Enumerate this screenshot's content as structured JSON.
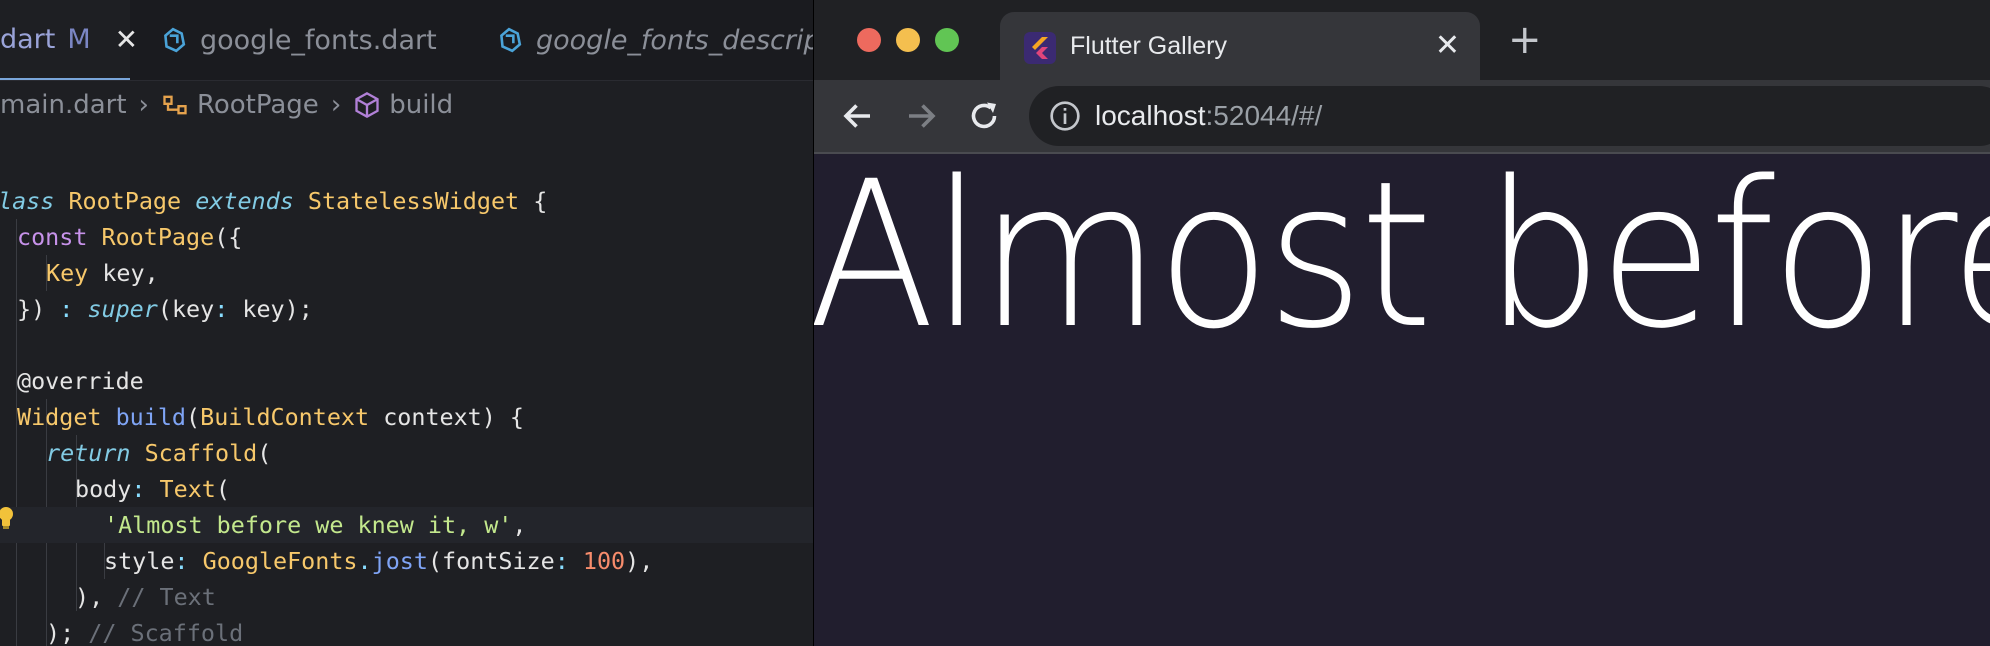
{
  "editor": {
    "tabs": [
      {
        "label": "dart",
        "modified": "M",
        "active": true
      },
      {
        "label": "google_fonts.dart",
        "active": false
      },
      {
        "label": "google_fonts_descriptc",
        "active": false,
        "preview": true
      }
    ],
    "breadcrumb": {
      "file": "main.dart",
      "class": "RootPage",
      "method": "build"
    },
    "code": {
      "l1": {
        "a": "lass",
        "b": "RootPage",
        "c": "extends",
        "d": "StatelessWidget",
        "e": " {"
      },
      "l2": {
        "a": "const",
        "b": "RootPage",
        "c": "({"
      },
      "l3": {
        "a": "Key",
        "b": " key,"
      },
      "l4": {
        "a": "}) ",
        "b": ":",
        "c": "super",
        "d": "(key",
        "e": ":",
        "f": " key);"
      },
      "l5": {
        "a": "@override"
      },
      "l6": {
        "a": "Widget",
        "b": "build",
        "c": "(",
        "d": "BuildContext",
        "e": " context) {"
      },
      "l7": {
        "a": "return",
        "b": "Scaffold",
        "c": "("
      },
      "l8": {
        "a": "body",
        "b": ":",
        "c": "Text",
        "d": "("
      },
      "l9": {
        "a": "'Almost before we knew it, w'",
        "b": ","
      },
      "l10": {
        "a": "style",
        "b": ":",
        "c": "GoogleFonts",
        "d": ".",
        "e": "jost",
        "f": "(fontSize",
        "g": ":",
        "h": "100",
        "i": "),"
      },
      "l11": {
        "a": "),",
        "b": "// Text"
      },
      "l12": {
        "a": ");",
        "b": "// Scaffold"
      }
    }
  },
  "browser": {
    "tab_title": "Flutter Gallery",
    "new_tab": "+",
    "url_host": "localhost",
    "url_rest": ":52044/#/",
    "content_text": "Almost before",
    "colors": {
      "red": "#ff5f57",
      "yellow": "#febc2e",
      "green": "#28c840"
    }
  }
}
